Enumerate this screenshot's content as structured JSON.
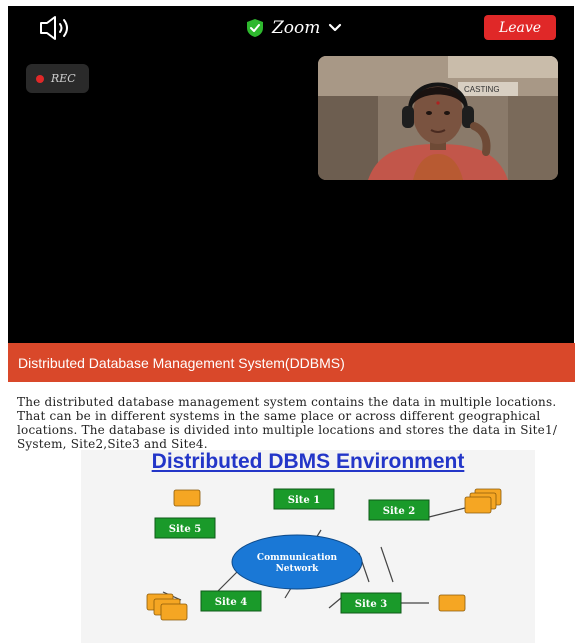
{
  "meeting": {
    "title": "Zoom",
    "leave_label": "Leave",
    "rec_label": "REC",
    "icons": {
      "speaker": "speaker-icon",
      "shield": "shield-check-icon",
      "chevron": "chevron-down-icon"
    },
    "colors": {
      "leave": "#e02828",
      "shield": "#2eb82e",
      "rec_dot": "#e02828"
    },
    "participant_tile_text": "CASTING"
  },
  "slide": {
    "header": "Distributed Database Management System(DDBMS)",
    "paragraph": "The distributed database management system contains the data in multiple locations. That can be in different systems in the same place or across different geographical locations. The database is divided into multiple locations and stores the data in Site1/ System, Site2,Site3 and Site4.",
    "header_color": "#d9482a",
    "diagram": {
      "title": "Distributed DBMS Environment",
      "network_line1": "Communication",
      "network_line2": "Network",
      "sites": [
        "Site 1",
        "Site 2",
        "Site 3",
        "Site 4",
        "Site 5"
      ],
      "colors": {
        "site": "#1a9a2a",
        "network": "#1a78d6",
        "database": "#f5a623",
        "title": "#2336c8"
      }
    }
  }
}
